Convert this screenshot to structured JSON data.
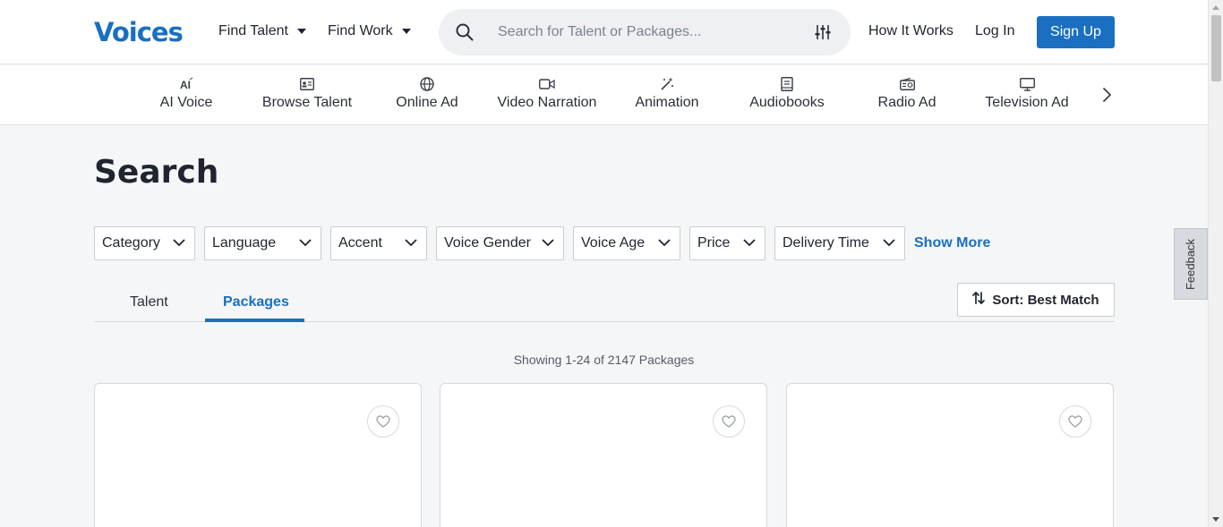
{
  "header": {
    "logo": "Voices",
    "find_talent": "Find Talent",
    "find_work": "Find Work",
    "search_placeholder": "Search for Talent or Packages...",
    "how_it_works": "How It Works",
    "log_in": "Log In",
    "sign_up": "Sign Up"
  },
  "categories": [
    {
      "label": "AI Voice",
      "icon": "ai-icon"
    },
    {
      "label": "Browse Talent",
      "icon": "id-card-icon"
    },
    {
      "label": "Online Ad",
      "icon": "globe-icon"
    },
    {
      "label": "Video Narration",
      "icon": "video-camera-icon"
    },
    {
      "label": "Animation",
      "icon": "magic-wand-icon"
    },
    {
      "label": "Audiobooks",
      "icon": "book-icon"
    },
    {
      "label": "Radio Ad",
      "icon": "radio-icon"
    },
    {
      "label": "Television Ad",
      "icon": "monitor-icon"
    }
  ],
  "page": {
    "title": "Search",
    "showing": "Showing 1-24 of 2147 Packages"
  },
  "filters": [
    "Category",
    "Language",
    "Accent",
    "Voice Gender",
    "Voice Age",
    "Price",
    "Delivery Time"
  ],
  "show_more": "Show More",
  "tabs": [
    {
      "label": "Talent",
      "active": false
    },
    {
      "label": "Packages",
      "active": true
    }
  ],
  "sort": {
    "label": "Sort: Best Match"
  },
  "feedback": "Feedback",
  "colors": {
    "accent": "#1a6fc0",
    "background": "#f5f6f8"
  }
}
